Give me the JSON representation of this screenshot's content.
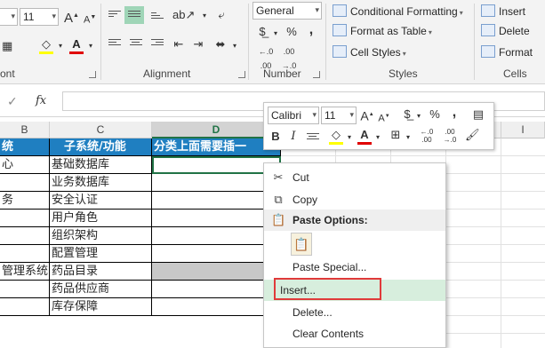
{
  "ribbon": {
    "font_size": "11",
    "font_group_label": "ont",
    "alignment_group_label": "Alignment",
    "number_format": "General",
    "number_group_label": "Number",
    "conditional_formatting": "Conditional Formatting",
    "format_as_table": "Format as Table",
    "cell_styles": "Cell Styles",
    "styles_group_label": "Styles",
    "insert": "Insert",
    "delete": "Delete",
    "format": "Format",
    "cells_group_label": "Cells",
    "percent": "%",
    "comma": ","
  },
  "formula_bar": {
    "check": "✓",
    "fx": "fx",
    "value": ""
  },
  "columns": {
    "b": "B",
    "c": "C",
    "d": "D",
    "i": "I"
  },
  "rows": [
    {
      "b": "统",
      "c": "子系统/功能",
      "d": "分类上面需要插一"
    },
    {
      "b": "心",
      "c": "基础数据库",
      "d": ""
    },
    {
      "b": "",
      "c": "业务数据库",
      "d": ""
    },
    {
      "b": "务",
      "c": "安全认证",
      "d": ""
    },
    {
      "b": "",
      "c": "用户角色",
      "d": ""
    },
    {
      "b": "",
      "c": "组织架构",
      "d": ""
    },
    {
      "b": "",
      "c": "配置管理",
      "d": ""
    },
    {
      "b": "管理系统",
      "c": "药品目录",
      "d": ""
    },
    {
      "b": "",
      "c": "药品供应商",
      "d": ""
    },
    {
      "b": "",
      "c": "库存保障",
      "d": ""
    }
  ],
  "mini_toolbar": {
    "font": "Calibri",
    "size": "11",
    "bold": "B",
    "italic": "I",
    "percent": "%",
    "comma": ","
  },
  "context_menu": {
    "items": [
      {
        "label": "Cut",
        "icon": "scissors-icon"
      },
      {
        "label": "Copy",
        "icon": "copy-icon"
      },
      {
        "label": "Paste Options:",
        "icon": "paste-icon"
      },
      {
        "label": "Paste Special...",
        "icon": ""
      },
      {
        "label": "Insert...",
        "icon": ""
      },
      {
        "label": "Delete...",
        "icon": ""
      },
      {
        "label": "Clear Contents",
        "icon": ""
      }
    ]
  },
  "colors": {
    "header_blue": "#1f7fc1",
    "excel_green": "#217346",
    "highlight": "#d7eedd",
    "red_box": "#e03a3a"
  }
}
